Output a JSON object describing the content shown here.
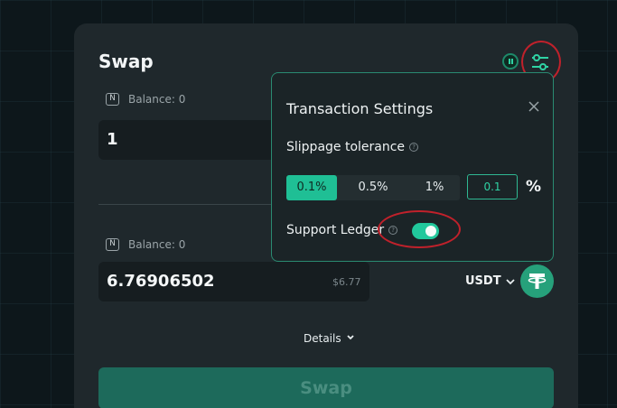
{
  "title": "Swap",
  "from": {
    "token_badge": "N",
    "balance": "Balance: 0",
    "amount": "1"
  },
  "to": {
    "token_badge": "N",
    "balance": "Balance: 0",
    "amount": "6.76906502",
    "usd_value": "$6.77",
    "token_symbol": "USDT"
  },
  "details_label": "Details",
  "swap_button_label": "Swap",
  "settings": {
    "title": "Transaction Settings",
    "slippage_label": "Slippage tolerance",
    "slippage_options": [
      "0.1%",
      "0.5%",
      "1%"
    ],
    "selected_slippage": "0.1%",
    "custom_slippage_value": "0.1",
    "percent_symbol": "%",
    "support_ledger_label": "Support Ledger",
    "support_ledger_enabled": true
  },
  "colors": {
    "accent": "#21c89c",
    "annotation": "#c0212b",
    "card": "#1f282c",
    "background": "#0d171b"
  }
}
